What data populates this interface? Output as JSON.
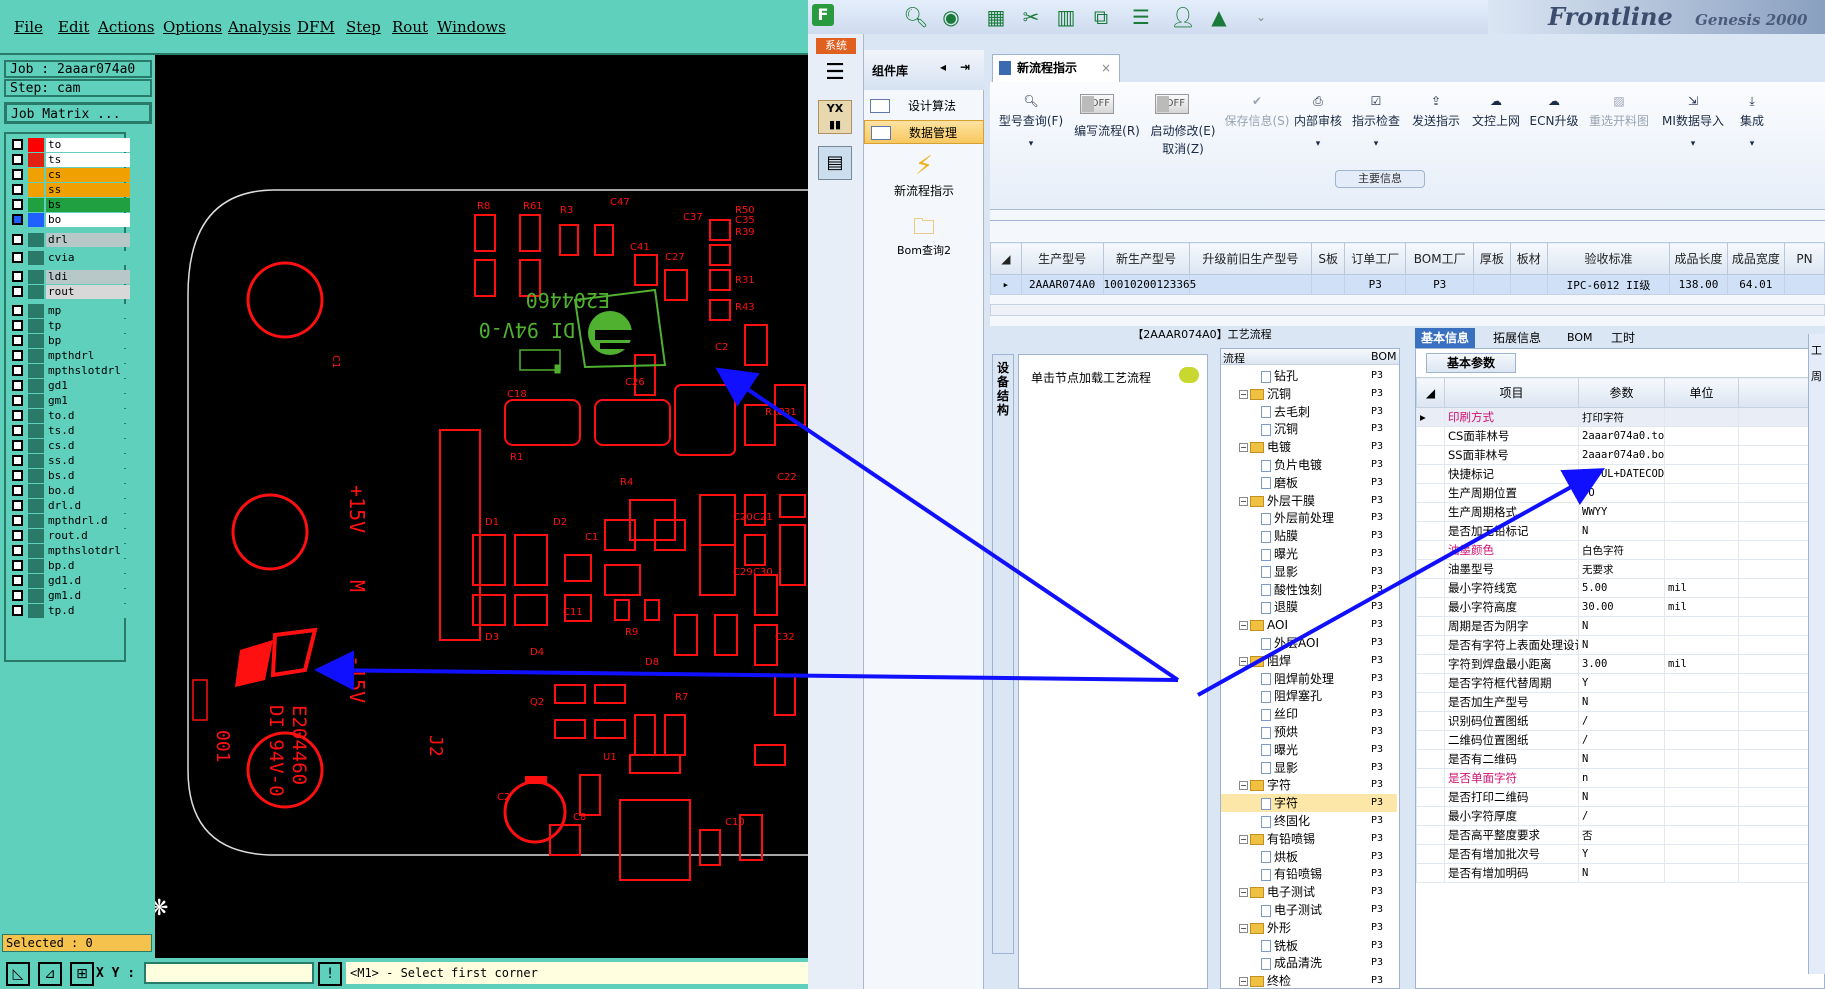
{
  "cam": {
    "menu": [
      "File",
      "Edit",
      "Actions",
      "Options",
      "Analysis",
      "DFM",
      "Step",
      "Rout",
      "Windows"
    ],
    "job_label": "Job : 2aaar074a0",
    "step_label": "Step: cam",
    "job_matrix_label": "Job Matrix ...",
    "layers": [
      {
        "name": "to",
        "color": "#ff0000",
        "bg": "#ffffff"
      },
      {
        "name": "ts",
        "color": "#e02010",
        "bg": "#ffffff"
      },
      {
        "name": "cs",
        "color": "#f0a000",
        "bg": "#f0a000"
      },
      {
        "name": "ss",
        "color": "#f0a000",
        "bg": "#f0a000"
      },
      {
        "name": "bs",
        "color": "#20a040",
        "bg": "#20a040"
      },
      {
        "name": "bo",
        "color": "#2060ff",
        "bg": "#ffffff"
      },
      {
        "name": "drl",
        "color": "#2a7a6a",
        "bg": "#b8c8c8"
      },
      {
        "name": "cvia",
        "color": "#2a7a6a",
        "bg": "#5fd0bb"
      },
      {
        "name": "ldi",
        "color": "#2a7a6a",
        "bg": "#b8c8c8"
      },
      {
        "name": "rout",
        "color": "#2a7a6a",
        "bg": "#d8d8d8"
      },
      {
        "name": "mp",
        "color": "#2a7a6a",
        "bg": "#5fd0bb"
      },
      {
        "name": "tp",
        "color": "#2a7a6a",
        "bg": "#5fd0bb"
      },
      {
        "name": "bp",
        "color": "#2a7a6a",
        "bg": "#5fd0bb"
      },
      {
        "name": "mpthdrl",
        "color": "#2a7a6a",
        "bg": "#5fd0bb"
      },
      {
        "name": "mpthslotdrl",
        "color": "#2a7a6a",
        "bg": "#5fd0bb"
      },
      {
        "name": "gd1",
        "color": "#2a7a6a",
        "bg": "#5fd0bb"
      },
      {
        "name": "gm1",
        "color": "#2a7a6a",
        "bg": "#5fd0bb"
      },
      {
        "name": "to.d",
        "color": "#2a7a6a",
        "bg": "#5fd0bb"
      },
      {
        "name": "ts.d",
        "color": "#2a7a6a",
        "bg": "#5fd0bb"
      },
      {
        "name": "cs.d",
        "color": "#2a7a6a",
        "bg": "#5fd0bb"
      },
      {
        "name": "ss.d",
        "color": "#2a7a6a",
        "bg": "#5fd0bb"
      },
      {
        "name": "bs.d",
        "color": "#2a7a6a",
        "bg": "#5fd0bb"
      },
      {
        "name": "bo.d",
        "color": "#2a7a6a",
        "bg": "#5fd0bb"
      },
      {
        "name": "drl.d",
        "color": "#2a7a6a",
        "bg": "#5fd0bb"
      },
      {
        "name": "mpthdrl.d",
        "color": "#2a7a6a",
        "bg": "#5fd0bb"
      },
      {
        "name": "rout.d",
        "color": "#2a7a6a",
        "bg": "#5fd0bb"
      },
      {
        "name": "mpthslotdrl",
        "color": "#2a7a6a",
        "bg": "#5fd0bb"
      },
      {
        "name": "bp.d",
        "color": "#2a7a6a",
        "bg": "#5fd0bb"
      },
      {
        "name": "gd1.d",
        "color": "#2a7a6a",
        "bg": "#5fd0bb"
      },
      {
        "name": "gm1.d",
        "color": "#2a7a6a",
        "bg": "#5fd0bb"
      },
      {
        "name": "tp.d",
        "color": "#2a7a6a",
        "bg": "#5fd0bb"
      }
    ],
    "selected_label": "Selected : 0",
    "xy_label": "X Y :",
    "prompt": "<M1> - Select first corner",
    "board": {
      "silk_green_1": "E204460",
      "silk_green_2": "DI 94V-0",
      "silk_red_1": "E204460",
      "silk_red_2": "DI 94V-0",
      "plus15": "+15V",
      "m_label": "M",
      "minus15": "-15V",
      "j2": "J2",
      "num_001": "001",
      "refs": [
        "R8",
        "R61",
        "R3",
        "C47",
        "C37",
        "R50",
        "C35",
        "R39",
        "C41",
        "C27",
        "R31",
        "R43",
        "C26",
        "C18",
        "R1",
        "C31",
        "R10",
        "C2",
        "R4",
        "C22",
        "D1",
        "D2",
        "C20",
        "C21",
        "C29",
        "C30",
        "D3",
        "C11",
        "R9",
        "D4",
        "Q2",
        "C32",
        "D8",
        "R7",
        "U1",
        "C2",
        "C8",
        "C10",
        "C1"
      ]
    },
    "arrow_color": "#1010ff"
  },
  "app": {
    "system_tab": "系统",
    "brand": "Frontline",
    "brand_sub": "Genesis 2000",
    "component_lib_label": "组件库",
    "comp_items": [
      "设计算法",
      "数据管理"
    ],
    "comp_tiles": [
      "新流程指示",
      "Bom查询2"
    ],
    "nav_yx": "YX",
    "tab_label": "新流程指示",
    "tab_close": "×",
    "ribbon": [
      {
        "label": "型号查询(F)",
        "icon": "search-icon"
      },
      {
        "label": "编写流程(R)",
        "icon": "toggle"
      },
      {
        "label": "启动修改(E)",
        "icon": "toggle"
      },
      {
        "label": "保存信息(S)",
        "icon": "check-icon",
        "disabled": true
      },
      {
        "label": "内部审核",
        "icon": "print-icon"
      },
      {
        "label": "指示检查",
        "icon": "checklist-icon"
      },
      {
        "label": "发送指示",
        "icon": "upload-icon"
      },
      {
        "label": "文控上网",
        "icon": "cloud-icon"
      },
      {
        "label": "ECN升级",
        "icon": "cloud-up-icon"
      },
      {
        "label": "重选开料图",
        "icon": "image-icon",
        "disabled": true
      },
      {
        "label": "MI数据导入",
        "icon": "import-icon"
      },
      {
        "label": "集成",
        "icon": "download-icon"
      }
    ],
    "toggle_off": "OFF",
    "cancel_label": "取消(Z)",
    "main_info_title": "主要信息",
    "main_grid": {
      "headers": [
        "生产型号",
        "新生产型号",
        "升级前旧生产型号",
        "S板",
        "订单工厂",
        "BOM工厂",
        "厚板",
        "板材",
        "验收标准",
        "成品长度",
        "成品宽度",
        "PN"
      ],
      "row": [
        "2AAAR074A0",
        "10010200123365",
        "",
        "",
        "P3",
        "P3",
        "",
        "",
        "IPC-6012 II级",
        "138.00",
        "64.01",
        ""
      ]
    },
    "proc_title": "【2AAAR074A0】工艺流程",
    "vert_tab": "设备结构",
    "proc_click": "单击节点加载工艺流程",
    "tree_header": [
      "流程",
      "BOM"
    ],
    "tree": [
      {
        "name": "钻孔",
        "level": 2,
        "type": "doc",
        "p3": "P3"
      },
      {
        "name": "沉铜",
        "level": 1,
        "type": "fold",
        "p3": "P3"
      },
      {
        "name": "去毛刺",
        "level": 2,
        "type": "doc",
        "p3": "P3"
      },
      {
        "name": "沉铜",
        "level": 2,
        "type": "doc",
        "p3": "P3"
      },
      {
        "name": "电镀",
        "level": 1,
        "type": "fold",
        "p3": "P3"
      },
      {
        "name": "负片电镀",
        "level": 2,
        "type": "doc",
        "p3": "P3"
      },
      {
        "name": "磨板",
        "level": 2,
        "type": "doc",
        "p3": "P3"
      },
      {
        "name": "外层干膜",
        "level": 1,
        "type": "fold",
        "p3": "P3"
      },
      {
        "name": "外层前处理",
        "level": 2,
        "type": "doc",
        "p3": "P3"
      },
      {
        "name": "贴膜",
        "level": 2,
        "type": "doc",
        "p3": "P3"
      },
      {
        "name": "曝光",
        "level": 2,
        "type": "doc",
        "p3": "P3"
      },
      {
        "name": "显影",
        "level": 2,
        "type": "doc",
        "p3": "P3"
      },
      {
        "name": "酸性蚀刻",
        "level": 2,
        "type": "doc",
        "p3": "P3"
      },
      {
        "name": "退膜",
        "level": 2,
        "type": "doc",
        "p3": "P3"
      },
      {
        "name": "AOI",
        "level": 1,
        "type": "fold",
        "p3": "P3"
      },
      {
        "name": "外层AOI",
        "level": 2,
        "type": "doc",
        "p3": "P3"
      },
      {
        "name": "阻焊",
        "level": 1,
        "type": "fold",
        "p3": "P3"
      },
      {
        "name": "阻焊前处理",
        "level": 2,
        "type": "doc",
        "p3": "P3"
      },
      {
        "name": "阻焊塞孔",
        "level": 2,
        "type": "doc",
        "p3": "P3"
      },
      {
        "name": "丝印",
        "level": 2,
        "type": "doc",
        "p3": "P3"
      },
      {
        "name": "预烘",
        "level": 2,
        "type": "doc",
        "p3": "P3"
      },
      {
        "name": "曝光",
        "level": 2,
        "type": "doc",
        "p3": "P3"
      },
      {
        "name": "显影",
        "level": 2,
        "type": "doc",
        "p3": "P3"
      },
      {
        "name": "字符",
        "level": 1,
        "type": "fold",
        "p3": "P3"
      },
      {
        "name": "字符",
        "level": 2,
        "type": "doc",
        "p3": "P3",
        "selected": true
      },
      {
        "name": "终固化",
        "level": 2,
        "type": "doc",
        "p3": "P3"
      },
      {
        "name": "有铅喷锡",
        "level": 1,
        "type": "fold",
        "p3": "P3"
      },
      {
        "name": "烘板",
        "level": 2,
        "type": "doc",
        "p3": "P3"
      },
      {
        "name": "有铅喷锡",
        "level": 2,
        "type": "doc",
        "p3": "P3"
      },
      {
        "name": "电子测试",
        "level": 1,
        "type": "fold",
        "p3": "P3"
      },
      {
        "name": "电子测试",
        "level": 2,
        "type": "doc",
        "p3": "P3"
      },
      {
        "name": "外形",
        "level": 1,
        "type": "fold",
        "p3": "P3"
      },
      {
        "name": "铣板",
        "level": 2,
        "type": "doc",
        "p3": "P3"
      },
      {
        "name": "成品清洗",
        "level": 2,
        "type": "doc",
        "p3": "P3"
      },
      {
        "name": "终检",
        "level": 1,
        "type": "fold",
        "p3": "P3"
      }
    ],
    "right_tabs": [
      "基本信息",
      "拓展信息",
      "BOM",
      "工时"
    ],
    "basic_params_tab": "基本参数",
    "param_headers": [
      "项目",
      "参数",
      "单位"
    ],
    "params": [
      {
        "item": "印刷方式",
        "value": "打印字符",
        "unit": "",
        "pink": true,
        "selected": true
      },
      {
        "item": "CS面菲林号",
        "value": "2aaar074a0.to",
        "unit": ""
      },
      {
        "item": "SS面菲林号",
        "value": "2aaar074a0.bo",
        "unit": ""
      },
      {
        "item": "快捷标记",
        "value": "FP+UL+DATECODE",
        "unit": ""
      },
      {
        "item": "生产周期位置",
        "value": "TO",
        "unit": ""
      },
      {
        "item": "生产周期格式",
        "value": "WWYY",
        "unit": ""
      },
      {
        "item": "是否加无铅标记",
        "value": "N",
        "unit": ""
      },
      {
        "item": "油墨颜色",
        "value": "白色字符",
        "unit": "",
        "pink": true
      },
      {
        "item": "油墨型号",
        "value": "无要求",
        "unit": ""
      },
      {
        "item": "最小字符线宽",
        "value": "5.00",
        "unit": "mil"
      },
      {
        "item": "最小字符高度",
        "value": "30.00",
        "unit": "mil"
      },
      {
        "item": "周期是否为阴字",
        "value": "N",
        "unit": ""
      },
      {
        "item": "是否有字符上表面处理设计",
        "value": "N",
        "unit": ""
      },
      {
        "item": "字符到焊盘最小距离",
        "value": "3.00",
        "unit": "mil"
      },
      {
        "item": "是否字符框代替周期",
        "value": "Y",
        "unit": ""
      },
      {
        "item": "是否加生产型号",
        "value": "N",
        "unit": ""
      },
      {
        "item": "识别码位置图纸",
        "value": "/",
        "unit": ""
      },
      {
        "item": "二维码位置图纸",
        "value": "/",
        "unit": ""
      },
      {
        "item": "是否有二维码",
        "value": "N",
        "unit": ""
      },
      {
        "item": "是否单面字符",
        "value": "n",
        "unit": "",
        "pink": true
      },
      {
        "item": "是否打印二维码",
        "value": "N",
        "unit": ""
      },
      {
        "item": "最小字符厚度",
        "value": "/",
        "unit": ""
      },
      {
        "item": "是否高平整度要求",
        "value": "否",
        "unit": ""
      },
      {
        "item": "是否有增加批次号",
        "value": "Y",
        "unit": ""
      },
      {
        "item": "是否有增加明码",
        "value": "N",
        "unit": ""
      }
    ],
    "right_stub": [
      "工",
      "周"
    ]
  }
}
